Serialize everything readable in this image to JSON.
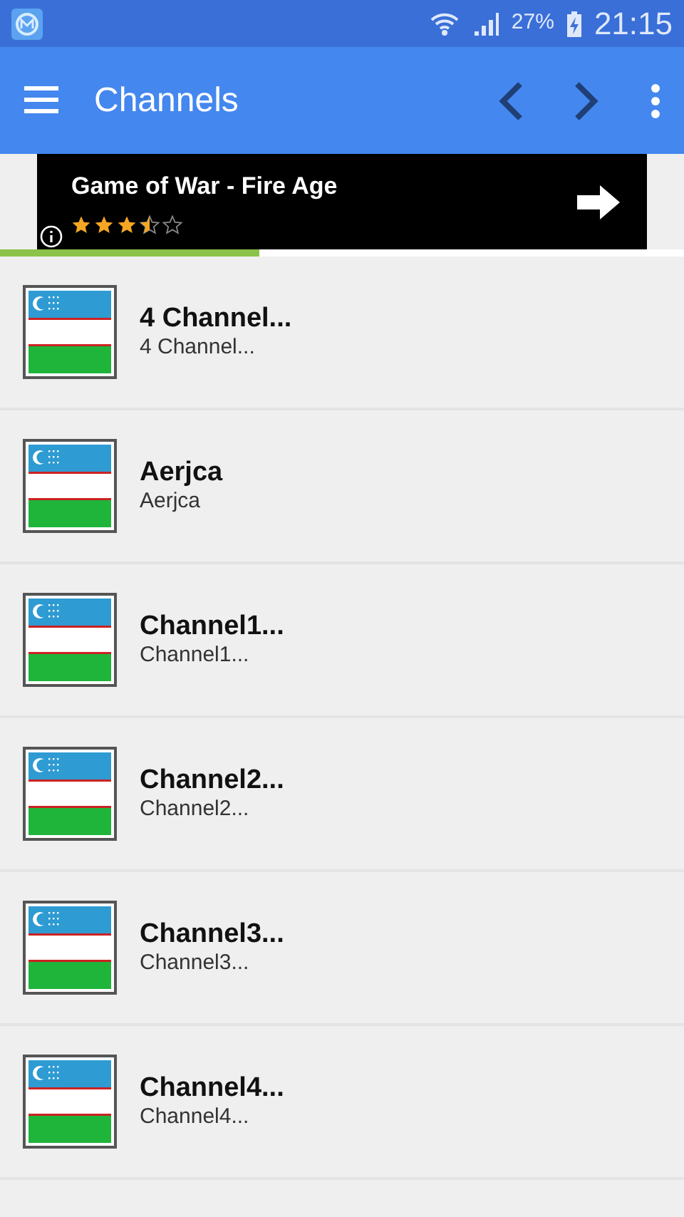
{
  "status_bar": {
    "battery": "27%",
    "time": "21:15"
  },
  "app_bar": {
    "title": "Channels"
  },
  "ad": {
    "title": "Game of War - Fire Age",
    "stars": 3.5
  },
  "loading": {
    "level": 0.38
  },
  "channels": [
    {
      "title": "4 Channel...",
      "subtitle": "4 Channel..."
    },
    {
      "title": "Aerjca",
      "subtitle": "Aerjca"
    },
    {
      "title": "Channel1...",
      "subtitle": "Channel1..."
    },
    {
      "title": "Channel2...",
      "subtitle": "Channel2..."
    },
    {
      "title": "Channel3...",
      "subtitle": "Channel3..."
    },
    {
      "title": "Channel4...",
      "subtitle": "Channel4..."
    }
  ]
}
